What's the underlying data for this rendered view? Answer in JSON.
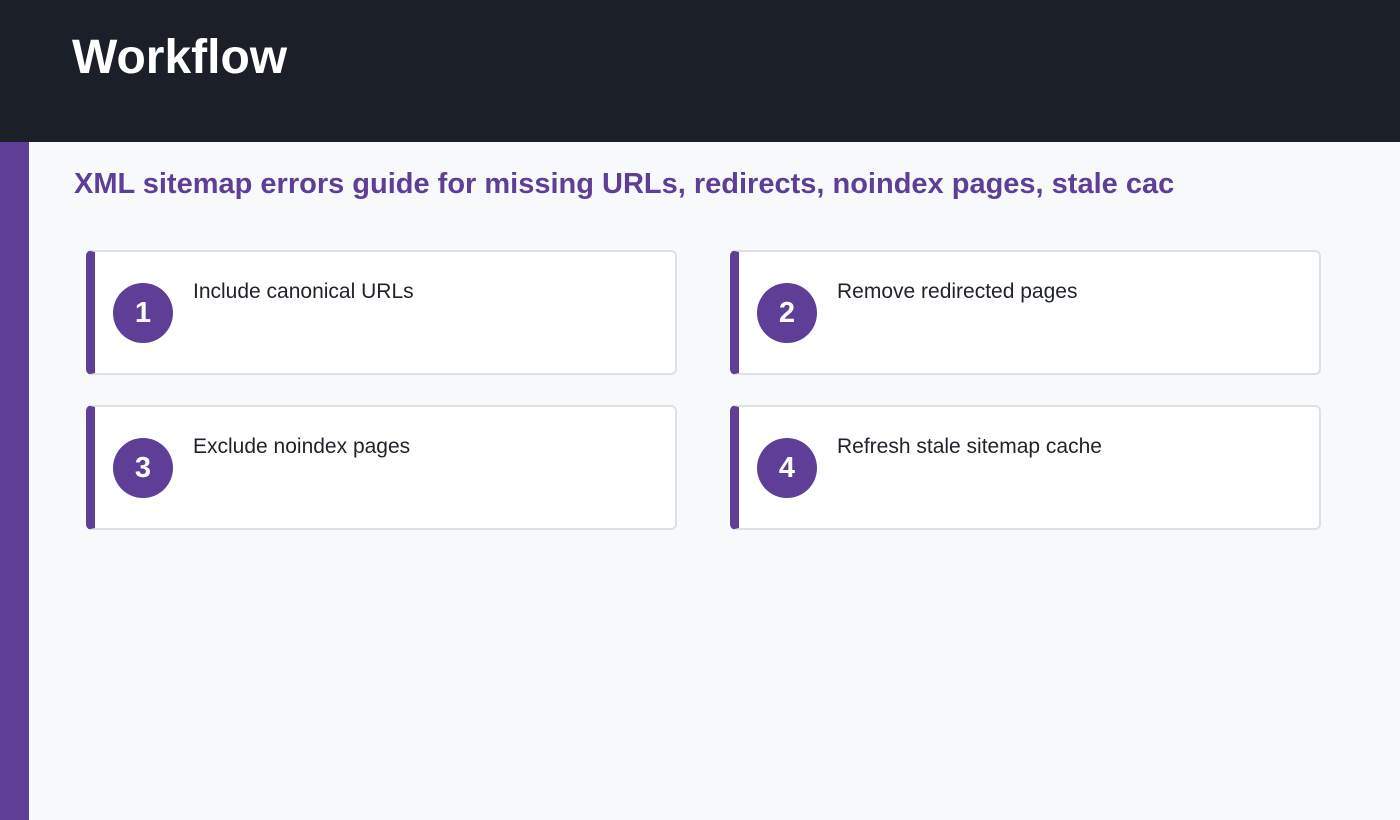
{
  "header": {
    "title": "Workflow"
  },
  "page": {
    "subtitle": "XML sitemap errors guide for missing URLs, redirects, noindex pages, stale cac"
  },
  "steps": [
    {
      "number": "1",
      "label": "Include canonical URLs"
    },
    {
      "number": "2",
      "label": "Remove redirected pages"
    },
    {
      "number": "3",
      "label": "Exclude noindex pages"
    },
    {
      "number": "4",
      "label": "Refresh stale sitemap cache"
    }
  ],
  "colors": {
    "header_bg": "#1b1f27",
    "accent": "#5e3e97",
    "page_bg": "#f8f9fb",
    "card_bg": "#ffffff",
    "card_border": "#dde1e6",
    "text": "#1f2329"
  }
}
